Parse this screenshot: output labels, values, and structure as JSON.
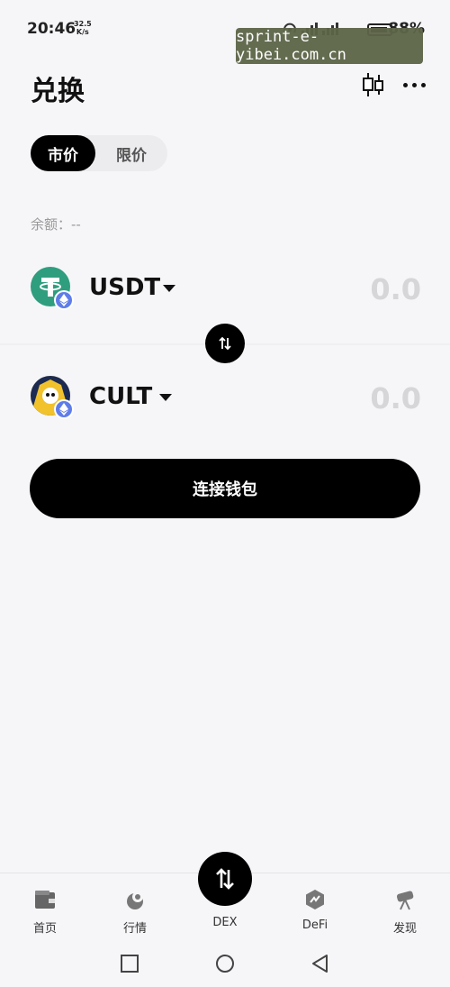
{
  "status_bar": {
    "time": "20:46",
    "speed_value": "32.5",
    "speed_unit": "K/s",
    "battery": "88%"
  },
  "watermark": "sprint-e-yibei.com.cn",
  "header": {
    "title": "兑换",
    "chart_icon": "candlestick-icon",
    "more_icon": "more-dots-icon"
  },
  "order_tabs": [
    {
      "label": "市价",
      "active": true
    },
    {
      "label": "限价",
      "active": false
    }
  ],
  "balance_label": "余额：--",
  "from_token": {
    "symbol": "USDT",
    "amount": "0.0",
    "logo": "tether-icon",
    "chain_badge": "ethereum-icon"
  },
  "to_token": {
    "symbol": "CULT",
    "amount": "0.0",
    "logo": "cult-icon",
    "chain_badge": "ethereum-icon"
  },
  "connect_button": "连接钱包",
  "bottom_nav": [
    {
      "label": "首页",
      "icon": "wallet-icon"
    },
    {
      "label": "行情",
      "icon": "market-icon"
    },
    {
      "label": "DEX",
      "icon": "swap-icon"
    },
    {
      "label": "DeFi",
      "icon": "defi-icon"
    },
    {
      "label": "发现",
      "icon": "telescope-icon"
    }
  ],
  "colors": {
    "background": "#f6f6f9",
    "primary": "#000000",
    "muted_amount": "#d6d6d9",
    "usdt_green": "#2f9e7e",
    "eth_blue": "#5f7de8"
  }
}
